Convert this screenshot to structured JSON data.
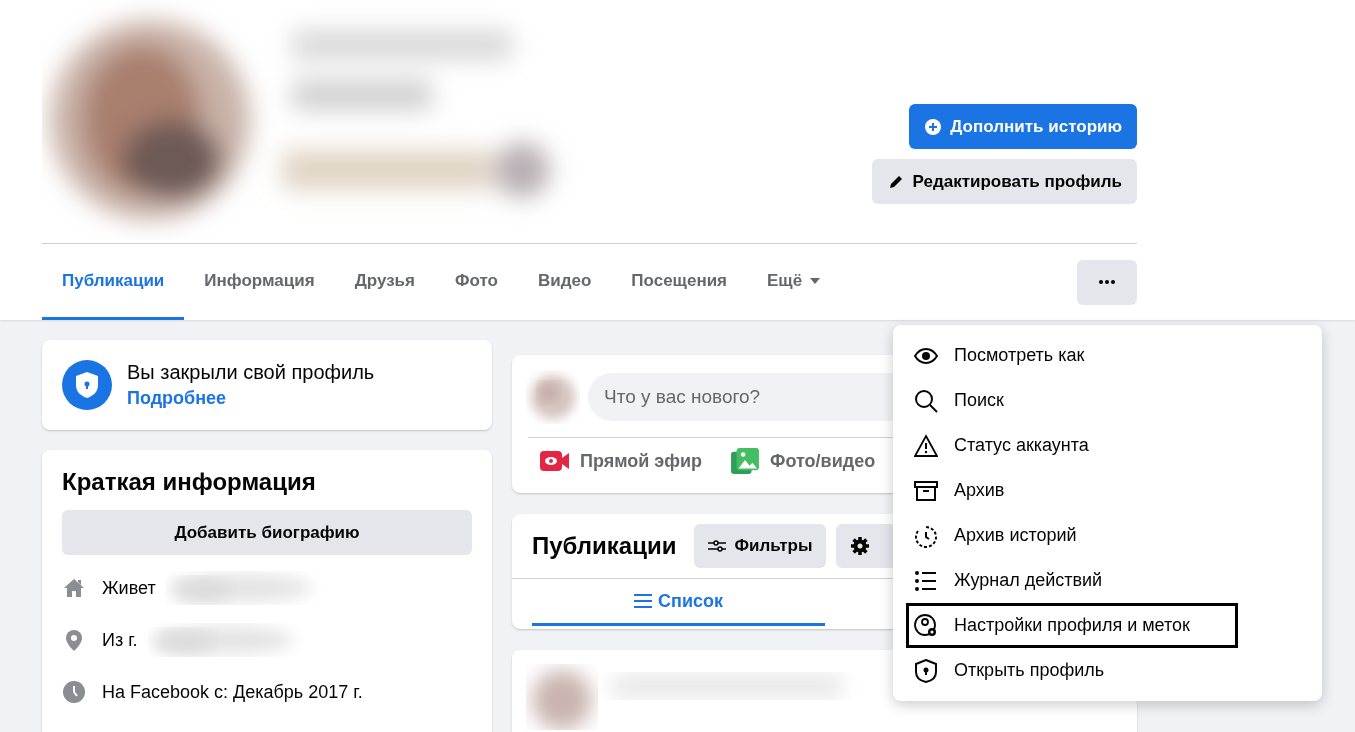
{
  "header": {
    "buttons": [
      {
        "kind": "primary",
        "label": "Дополнить историю"
      },
      {
        "kind": "secondary",
        "label": "Редактировать профиль"
      }
    ]
  },
  "tabs": [
    {
      "label": "Публикации",
      "selected": true
    },
    {
      "label": "Информация",
      "selected": false
    },
    {
      "label": "Друзья",
      "selected": false
    },
    {
      "label": "Фото",
      "selected": false
    },
    {
      "label": "Видео",
      "selected": false
    },
    {
      "label": "Посещения",
      "selected": false
    },
    {
      "label": "Ещё",
      "selected": false
    }
  ],
  "locked_notice": {
    "title": "Вы закрыли свой профиль",
    "link": "Подробнее"
  },
  "intro": {
    "title": "Краткая информация",
    "button": "Добавить биографию",
    "items": [
      "Живет",
      "Из г.",
      "На Facebook с: Декабрь 2017 г."
    ]
  },
  "composer": {
    "placeholder": "Что у вас нового?",
    "actions": [
      "Прямой эфир",
      "Фото/видео"
    ]
  },
  "posts": {
    "title": "Публикации",
    "filter_button": "Фильтры",
    "view_tabs": [
      {
        "label": "Список",
        "selected": true
      }
    ]
  },
  "menu": {
    "items": [
      {
        "label": "Посмотреть как",
        "outlined": false
      },
      {
        "label": "Поиск",
        "outlined": false
      },
      {
        "label": "Статус аккаунта",
        "outlined": false
      },
      {
        "label": "Архив",
        "outlined": false
      },
      {
        "label": "Архив историй",
        "outlined": false
      },
      {
        "label": "Журнал действий",
        "outlined": false
      },
      {
        "label": "Настройки профиля и меток",
        "outlined": true
      },
      {
        "label": "Открыть профиль",
        "outlined": false
      }
    ]
  }
}
